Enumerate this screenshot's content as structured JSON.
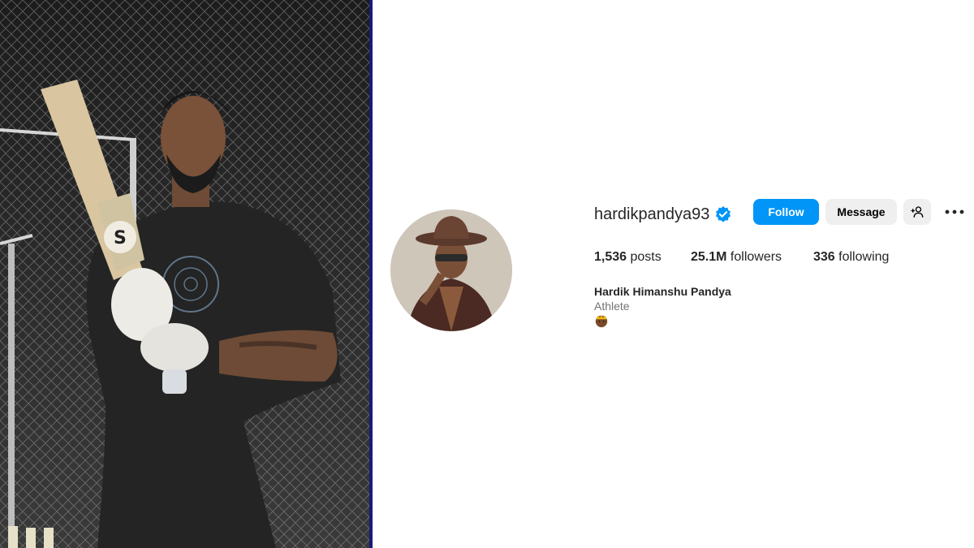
{
  "profile": {
    "username": "hardikpandya93",
    "verified": true,
    "full_name": "Hardik Himanshu Pandya",
    "category": "Athlete",
    "bio_emoji_icon": "crown-emoji-icon"
  },
  "actions": {
    "follow_label": "Follow",
    "message_label": "Message",
    "suggest_icon": "add-person-icon",
    "more_icon": "more-options-icon"
  },
  "stats": {
    "posts_count": "1,536",
    "posts_label": "posts",
    "followers_count": "25.1M",
    "followers_label": "followers",
    "following_count": "336",
    "following_label": "following"
  },
  "colors": {
    "follow_button": "#0095f6",
    "secondary_button": "#efefef",
    "verified_badge": "#0095f6",
    "muted_text": "#737373"
  }
}
